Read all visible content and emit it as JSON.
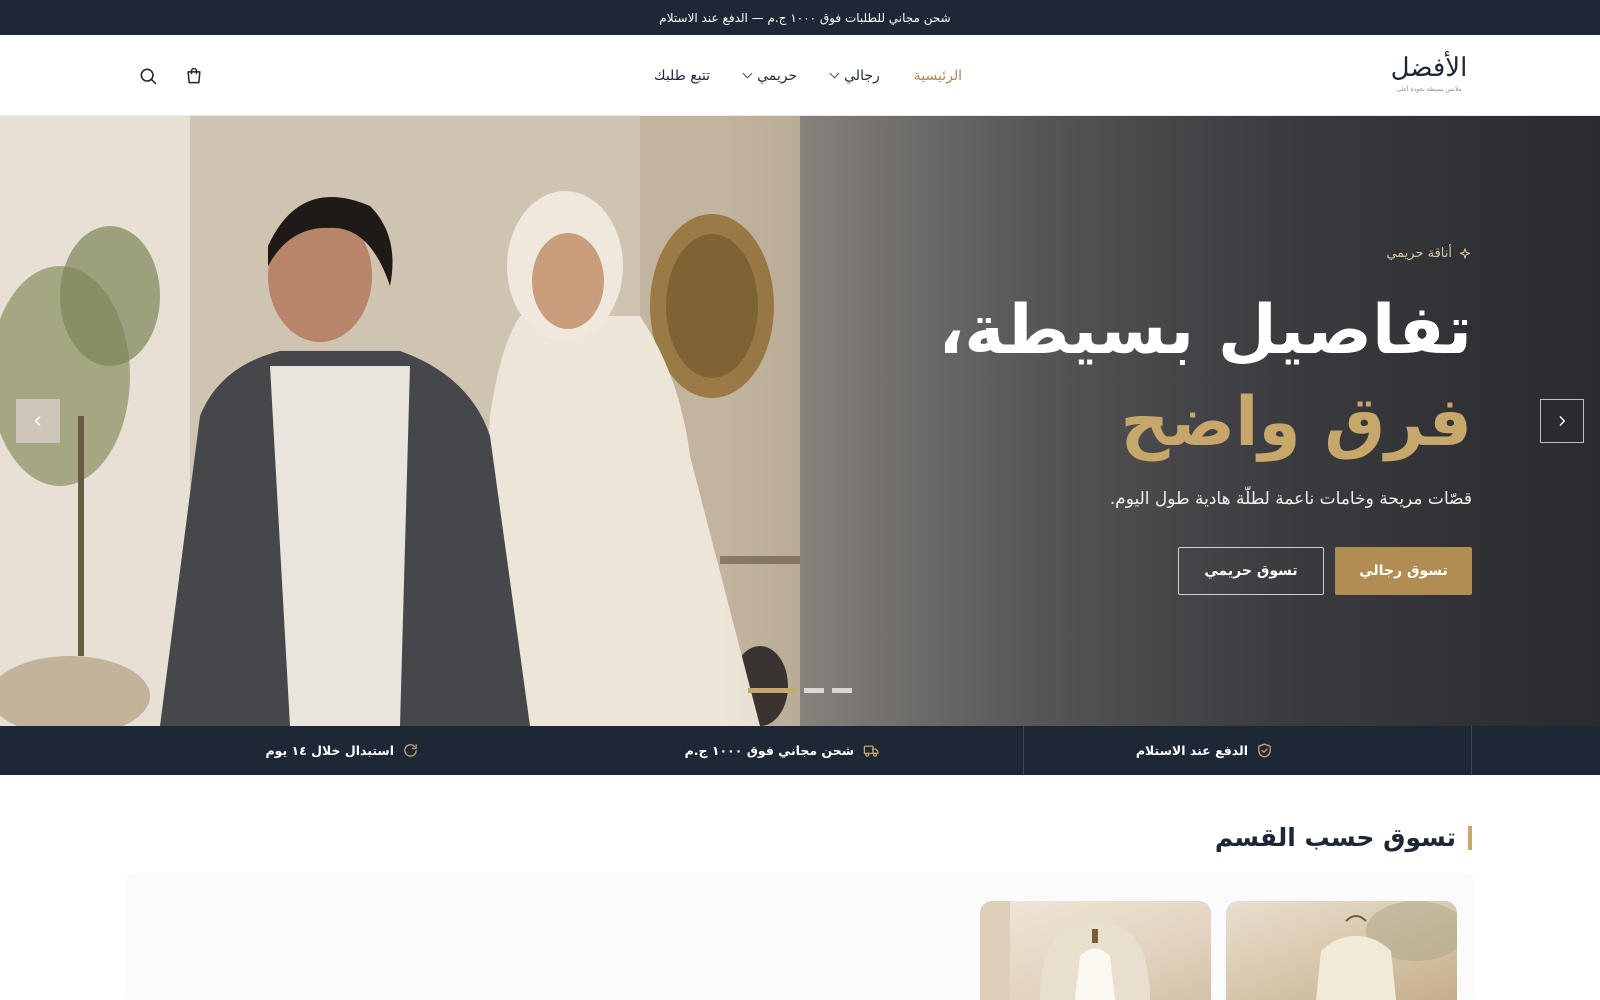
{
  "announcement": "شحن مجاني للطلبات فوق ١٠٠٠ ج.م — الدفع عند الاستلام",
  "header": {
    "logo_text": "الأفضل",
    "logo_tagline": "ملابس بسيطة بجودة أعلى",
    "nav": [
      {
        "label": "الرئيسية",
        "active": true,
        "dropdown": false
      },
      {
        "label": "رجالي",
        "active": false,
        "dropdown": true
      },
      {
        "label": "حريمي",
        "active": false,
        "dropdown": true
      },
      {
        "label": "تتبع طلبك",
        "active": false,
        "dropdown": false
      }
    ],
    "icons": [
      "search-icon",
      "cart-icon"
    ]
  },
  "hero": {
    "eyebrow": "أناقة حريمي",
    "headline_line1": "تفاصيل بسيطة،",
    "headline_line2": "فرق واضح",
    "subtext": "قصّات مريحة وخامات ناعمة لطلّة هادية طول اليوم.",
    "primary_button": "تسوق رجالي",
    "secondary_button": "تسوق حريمي",
    "slide_count": 3,
    "active_slide": 1
  },
  "features": [
    {
      "icon": "shield-check-icon",
      "label": "الدفع عند الاستلام"
    },
    {
      "icon": "truck-icon",
      "label": "شحن مجاني فوق ١٠٠٠ ج.م"
    },
    {
      "icon": "refresh-icon",
      "label": "استبدال خلال ١٤ يوم"
    }
  ],
  "section": {
    "title": "تسوق حسب القسم"
  },
  "colors": {
    "navy": "#1e2736",
    "gold": "#b08e53",
    "gold_light": "#c7a76a"
  }
}
